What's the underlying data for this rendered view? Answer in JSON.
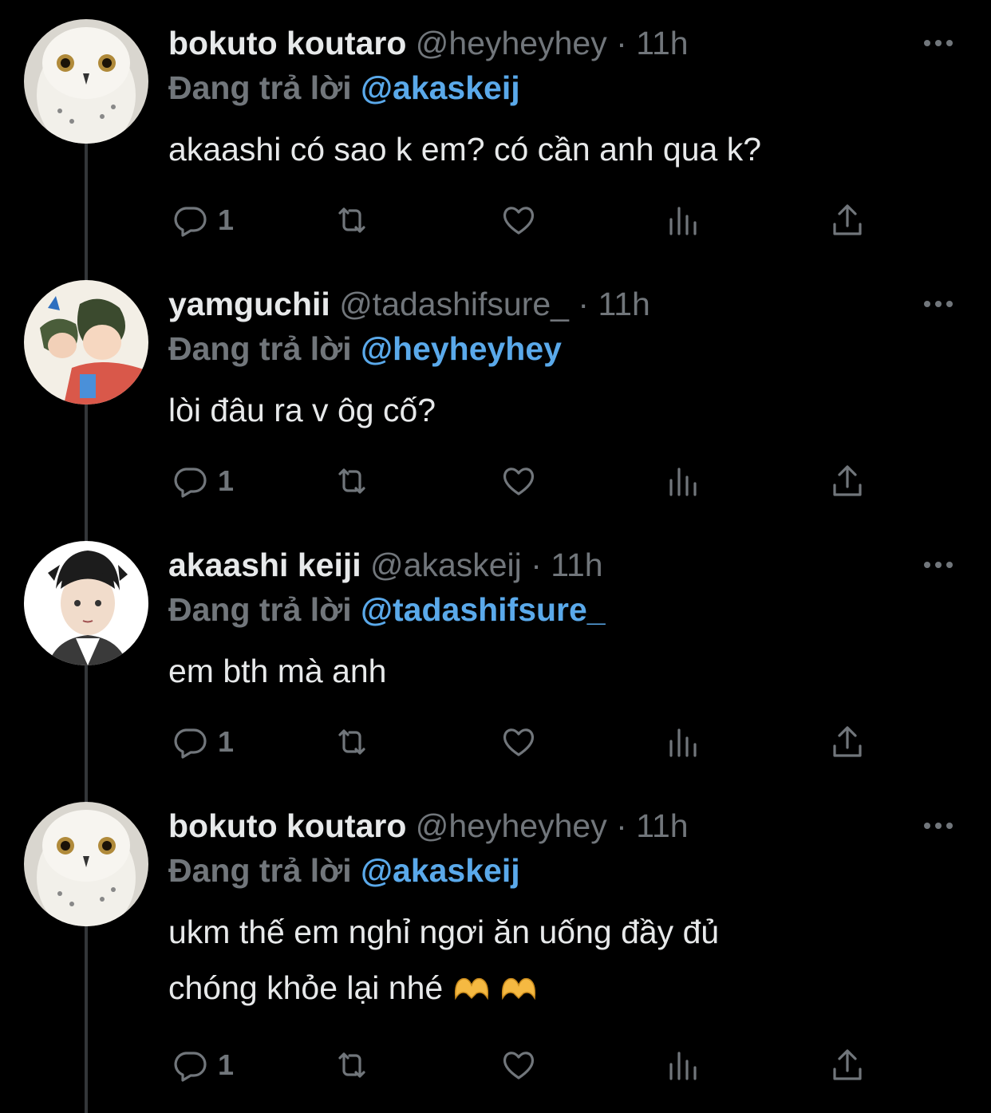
{
  "tweets": [
    {
      "name": "bokuto koutaro",
      "handle": "@heyheyhey",
      "separator": "·",
      "time": "11h",
      "reply_prefix": "Đang trả lời",
      "reply_to": "@akaskeij",
      "text": "akaashi có sao k em? có cần anh qua k?",
      "reply_count": "1",
      "avatar": "snowy-owl"
    },
    {
      "name": "yamguchii",
      "handle": "@tadashifsure_",
      "separator": "·",
      "time": "11h",
      "reply_prefix": "Đang trả lời",
      "reply_to": "@heyheyhey",
      "text": "lòi đâu ra v ôg cố?",
      "reply_count": "1",
      "avatar": "anime-characters"
    },
    {
      "name": "akaashi keiji",
      "handle": "@akaskeij",
      "separator": "·",
      "time": "11h",
      "reply_prefix": "Đang trả lời",
      "reply_to": "@tadashifsure_",
      "text": "em bth mà anh",
      "reply_count": "1",
      "avatar": "anime-boy"
    },
    {
      "name": "bokuto koutaro",
      "handle": "@heyheyhey",
      "separator": "·",
      "time": "11h",
      "reply_prefix": "Đang trả lời",
      "reply_to": "@akaskeij",
      "text_line1": "ukm thế em nghỉ ngơi ăn uống đầy đủ",
      "text_line2": "chóng khỏe lại nhé",
      "reply_count": "1",
      "avatar": "snowy-owl",
      "emoji": [
        "heart-hands",
        "heart-hands"
      ]
    }
  ],
  "colors": {
    "background": "#000000",
    "text": "#e7e9ea",
    "secondary": "#71767b",
    "mention": "#5aa9ea",
    "thread_line": "#333639"
  },
  "icons": [
    "reply-icon",
    "retweet-icon",
    "like-icon",
    "views-icon",
    "share-icon",
    "more-icon"
  ]
}
